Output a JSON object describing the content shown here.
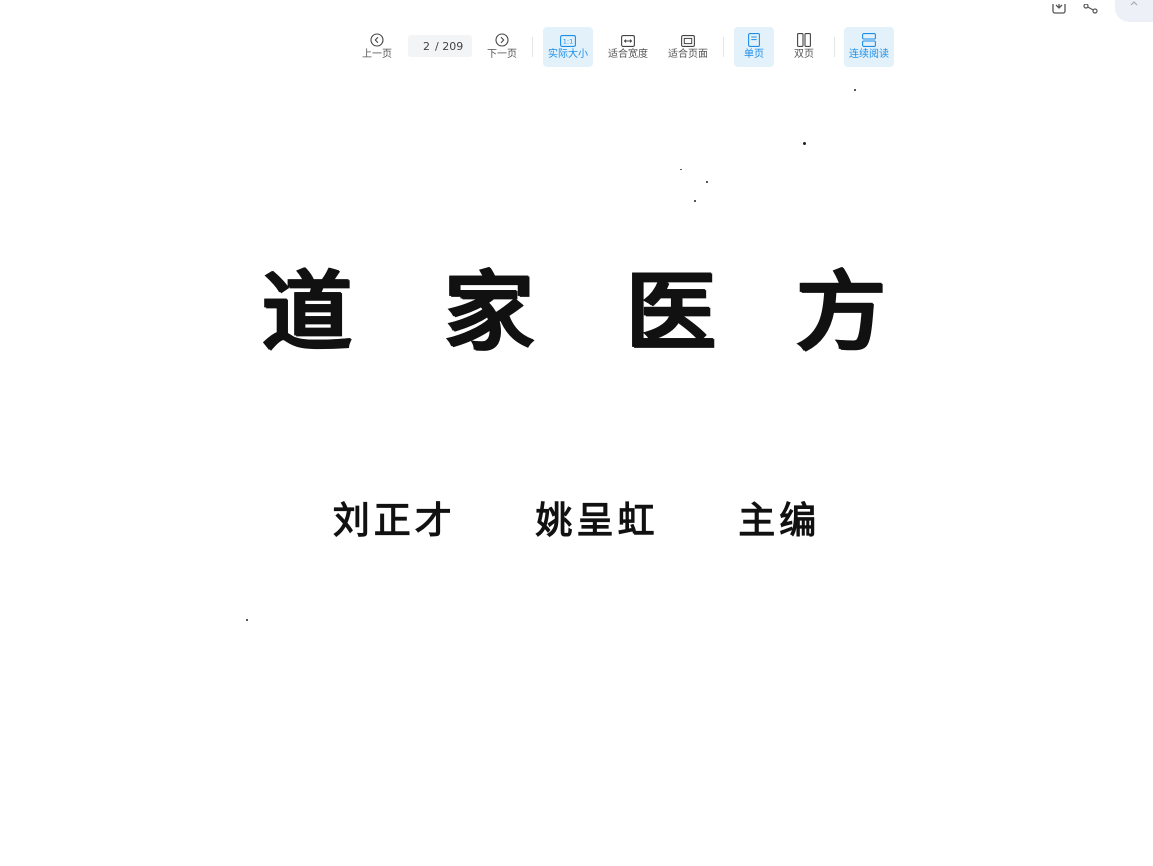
{
  "toolbar": {
    "prev_label": "上一页",
    "current_page": "2",
    "total_pages": "/ 209",
    "next_label": "下一页",
    "actual_size_label": "实际大小",
    "actual_size_icon_text": "1:1",
    "fit_width_label": "适合宽度",
    "fit_page_label": "适合页面",
    "single_page_label": "单页",
    "double_page_label": "双页",
    "continuous_label": "连续阅读",
    "accent_color": "#1c8ee8",
    "active_bg": "#e3f1fb"
  },
  "header_icons": [
    "download-icon",
    "share-icon",
    "chevron-up-icon"
  ],
  "document": {
    "title_chars": [
      "道",
      "家",
      "医",
      "方"
    ],
    "authors": [
      "刘正才",
      "姚呈虹",
      "主编"
    ]
  }
}
